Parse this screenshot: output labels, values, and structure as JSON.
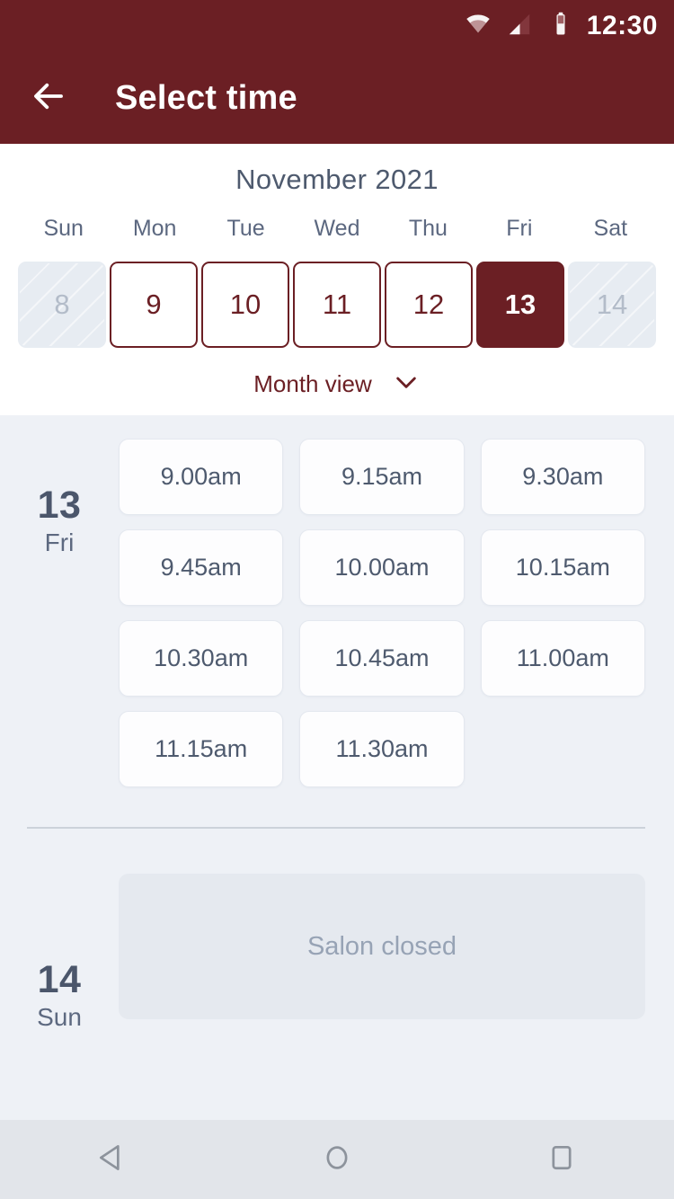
{
  "status_bar": {
    "time": "12:30",
    "icons": [
      "wifi-icon",
      "cellular-signal-icon",
      "battery-icon"
    ]
  },
  "app_bar": {
    "title": "Select time",
    "back_icon": "arrow-left-icon"
  },
  "calendar": {
    "month_title": "November 2021",
    "weekdays": [
      "Sun",
      "Mon",
      "Tue",
      "Wed",
      "Thu",
      "Fri",
      "Sat"
    ],
    "days": [
      {
        "number": "8",
        "state": "disabled"
      },
      {
        "number": "9",
        "state": "available"
      },
      {
        "number": "10",
        "state": "available"
      },
      {
        "number": "11",
        "state": "available"
      },
      {
        "number": "12",
        "state": "available"
      },
      {
        "number": "13",
        "state": "selected"
      },
      {
        "number": "14",
        "state": "disabled"
      }
    ],
    "month_view_label": "Month view",
    "month_view_icon": "chevron-down-icon"
  },
  "schedule": [
    {
      "day_number": "13",
      "day_name": "Fri",
      "slots": [
        "9.00am",
        "9.15am",
        "9.30am",
        "9.45am",
        "10.00am",
        "10.15am",
        "10.30am",
        "10.45am",
        "11.00am",
        "11.15am",
        "11.30am"
      ]
    },
    {
      "day_number": "14",
      "day_name": "Sun",
      "closed_message": "Salon closed"
    }
  ],
  "nav_bar": {
    "back_icon": "triangle-back-icon",
    "home_icon": "circle-home-icon",
    "recents_icon": "square-recents-icon"
  },
  "colors": {
    "brand": "#6b1f24",
    "body_bg": "#eef1f6",
    "panel_bg": "#ffffff",
    "text_slate": "#4e5a6e",
    "muted": "#97a3b5",
    "nav_bg": "#e2e5ea"
  }
}
